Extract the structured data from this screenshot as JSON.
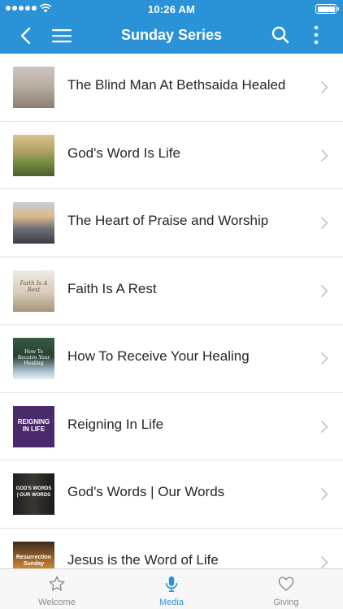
{
  "status_bar": {
    "time": "10:26 AM"
  },
  "nav": {
    "title": "Sunday Series"
  },
  "items": [
    {
      "title": "The Blind Man At Bethsaida Healed",
      "thumb_caption": ""
    },
    {
      "title": "God's Word Is Life",
      "thumb_caption": ""
    },
    {
      "title": "The Heart of Praise and Worship",
      "thumb_caption": ""
    },
    {
      "title": "Faith Is A Rest",
      "thumb_caption": "Faith Is A Rest"
    },
    {
      "title": "How To Receive Your Healing",
      "thumb_caption": "How To Receive Your Healing"
    },
    {
      "title": "Reigning In Life",
      "thumb_caption": "REIGNING IN LIFE"
    },
    {
      "title": "God's Words | Our Words",
      "thumb_caption": "GOD'S WORDS | OUR WORDS"
    },
    {
      "title": "Jesus is the Word of Life",
      "thumb_caption": "Resurrection Sunday"
    }
  ],
  "tabs": [
    {
      "label": "Welcome",
      "icon": "star-icon"
    },
    {
      "label": "Media",
      "icon": "microphone-icon",
      "active": true
    },
    {
      "label": "Giving",
      "icon": "heart-icon"
    }
  ],
  "colors": {
    "accent": "#2a93d8",
    "tab_inactive": "#8a8a8a",
    "separator": "#e3e3e3"
  }
}
